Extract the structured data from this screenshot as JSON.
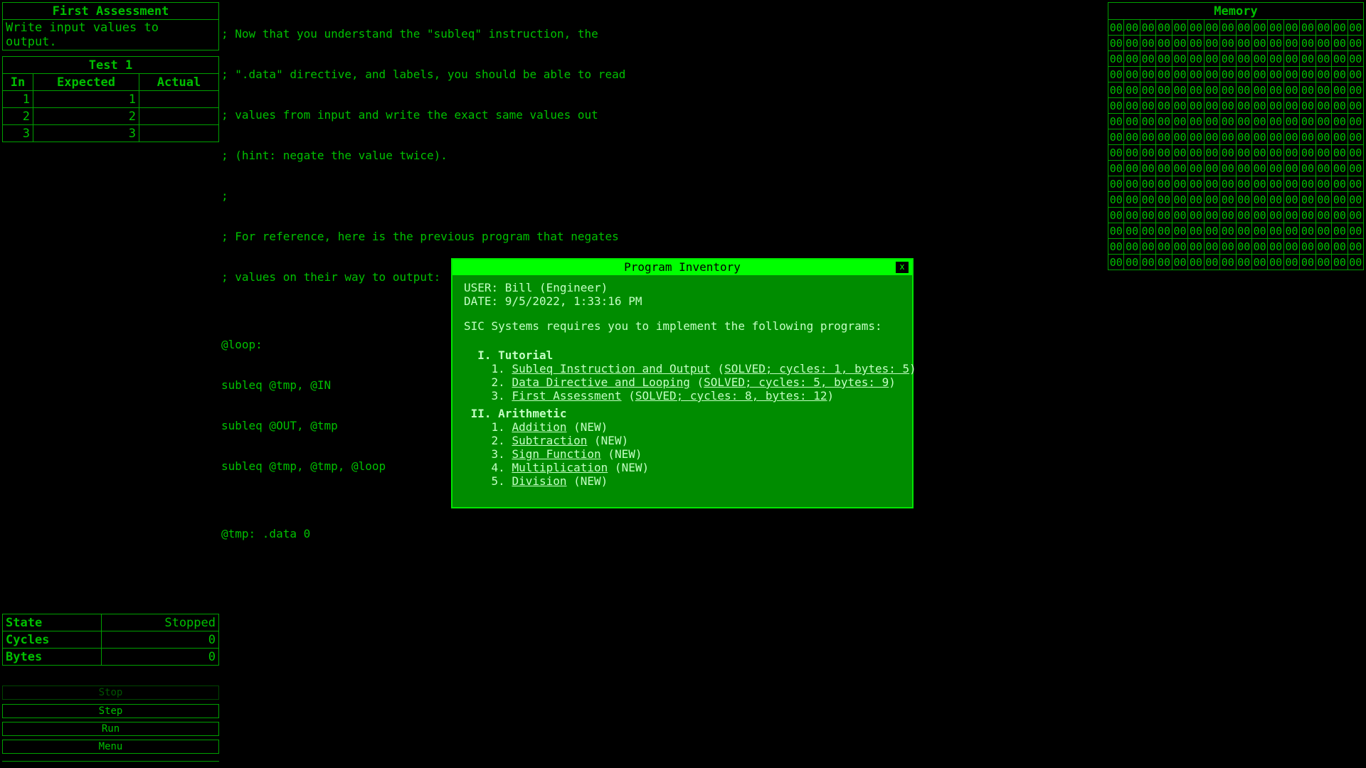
{
  "assessment": {
    "title": "First Assessment",
    "description": "Write input values to output."
  },
  "test": {
    "title": "Test 1",
    "headers": [
      "In",
      "Expected",
      "Actual"
    ],
    "rows": [
      {
        "in": "1",
        "expected": "1",
        "actual": ""
      },
      {
        "in": "2",
        "expected": "2",
        "actual": ""
      },
      {
        "in": "3",
        "expected": "3",
        "actual": ""
      }
    ]
  },
  "editor": {
    "lines": [
      "; Now that you understand the \"subleq\" instruction, the",
      "; \".data\" directive, and labels, you should be able to read",
      "; values from input and write the exact same values out",
      "; (hint: negate the value twice).",
      ";",
      "; For reference, here is the previous program that negates",
      "; values on their way to output:",
      "",
      "@loop:",
      "subleq @tmp, @IN",
      "subleq @OUT, @tmp",
      "subleq @tmp, @tmp, @loop",
      "",
      "@tmp: .data 0"
    ]
  },
  "memory": {
    "title": "Memory",
    "cell_value": "00",
    "rows": 16,
    "cols": 16
  },
  "stats": {
    "state_label": "State",
    "state_value": "Stopped",
    "cycles_label": "Cycles",
    "cycles_value": "0",
    "bytes_label": "Bytes",
    "bytes_value": "0"
  },
  "controls": {
    "stop": "Stop",
    "step": "Step",
    "run": "Run",
    "menu": "Menu"
  },
  "modal": {
    "title": "Program Inventory",
    "close": "x",
    "user": "USER: Bill (Engineer)",
    "date": "DATE: 9/5/2022, 1:33:16 PM",
    "intro": "SIC Systems requires you to implement the following programs:",
    "sections": [
      {
        "heading": "  I. Tutorial",
        "items": [
          {
            "num": "1.",
            "name": "Subleq Instruction and Output",
            "status": "SOLVED; cycles: 1, bytes: 5",
            "solved": true
          },
          {
            "num": "2.",
            "name": "Data Directive and Looping",
            "status": "SOLVED; cycles: 5, bytes: 9",
            "solved": true
          },
          {
            "num": "3.",
            "name": "First Assessment",
            "status": "SOLVED; cycles: 8, bytes: 12",
            "solved": true
          }
        ]
      },
      {
        "heading": " II. Arithmetic",
        "items": [
          {
            "num": "1.",
            "name": "Addition",
            "status": "NEW",
            "solved": false
          },
          {
            "num": "2.",
            "name": "Subtraction",
            "status": "NEW",
            "solved": false
          },
          {
            "num": "3.",
            "name": "Sign Function",
            "status": "NEW",
            "solved": false
          },
          {
            "num": "4.",
            "name": "Multiplication",
            "status": "NEW",
            "solved": false
          },
          {
            "num": "5.",
            "name": "Division",
            "status": "NEW",
            "solved": false
          }
        ]
      }
    ]
  },
  "colors": {
    "background": "#000000",
    "terminal_green": "#00c000",
    "modal_bg": "#008c00",
    "modal_header": "#00ff00",
    "modal_text": "#c4ffc4"
  }
}
